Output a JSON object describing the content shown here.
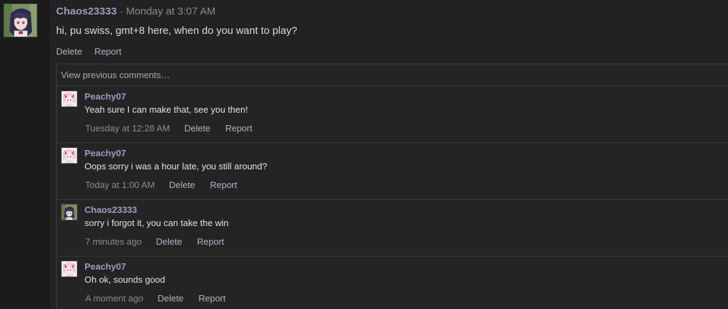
{
  "post": {
    "author": "Chaos23333",
    "separator": "·",
    "timestamp": "Monday at 3:07 AM",
    "body": "hi, pu swiss, gmt+8 here, when do you want to play?",
    "actions": {
      "delete": "Delete",
      "report": "Report"
    }
  },
  "comments": {
    "view_previous": "View previous comments…",
    "items": [
      {
        "author": "Peachy07",
        "text": "Yeah sure I can make that, see you then!",
        "time": "Tuesday at 12:28 AM",
        "delete": "Delete",
        "report": "Report",
        "avatar": "peachy-avatar"
      },
      {
        "author": "Peachy07",
        "text": "Oops sorry i was a hour late, you still around?",
        "time": "Today at 1:00 AM",
        "delete": "Delete",
        "report": "Report",
        "avatar": "peachy-avatar"
      },
      {
        "author": "Chaos23333",
        "text": "sorry i forgot it, you can take the win",
        "time": "7 minutes ago",
        "delete": "Delete",
        "report": "Report",
        "avatar": "chaos-avatar"
      },
      {
        "author": "Peachy07",
        "text": "Oh ok, sounds good",
        "time": "A moment ago",
        "delete": "Delete",
        "report": "Report",
        "avatar": "peachy-avatar"
      }
    ]
  },
  "colors": {
    "background": "#222222",
    "username": "#9c9cc2",
    "link": "#b2b2c8",
    "muted": "#8a8a8a",
    "text": "#dddddd"
  }
}
